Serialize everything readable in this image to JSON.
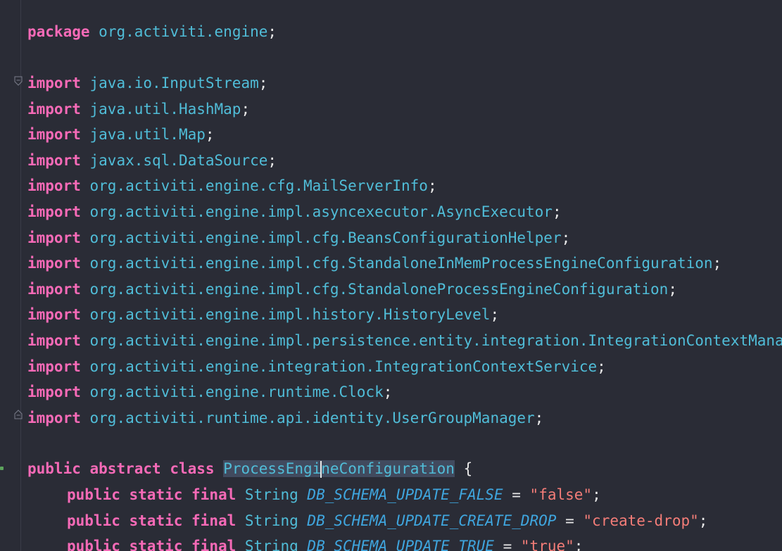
{
  "editor": {
    "package_line": {
      "keyword": "package",
      "name": "org.activiti.engine",
      "end": ";"
    },
    "imports": [
      {
        "keyword": "import",
        "path": "java.io.InputStream",
        "end": ";"
      },
      {
        "keyword": "import",
        "path": "java.util.HashMap",
        "end": ";"
      },
      {
        "keyword": "import",
        "path": "java.util.Map",
        "end": ";"
      },
      {
        "keyword": "import",
        "path": "javax.sql.DataSource",
        "end": ";"
      },
      {
        "keyword": "import",
        "path": "org.activiti.engine.cfg.MailServerInfo",
        "end": ";"
      },
      {
        "keyword": "import",
        "path": "org.activiti.engine.impl.asyncexecutor.AsyncExecutor",
        "end": ";"
      },
      {
        "keyword": "import",
        "path": "org.activiti.engine.impl.cfg.BeansConfigurationHelper",
        "end": ";"
      },
      {
        "keyword": "import",
        "path": "org.activiti.engine.impl.cfg.StandaloneInMemProcessEngineConfiguration",
        "end": ";"
      },
      {
        "keyword": "import",
        "path": "org.activiti.engine.impl.cfg.StandaloneProcessEngineConfiguration",
        "end": ";"
      },
      {
        "keyword": "import",
        "path": "org.activiti.engine.impl.history.HistoryLevel",
        "end": ";"
      },
      {
        "keyword": "import",
        "path": "org.activiti.engine.impl.persistence.entity.integration.IntegrationContextManager",
        "end": ";"
      },
      {
        "keyword": "import",
        "path": "org.activiti.engine.integration.IntegrationContextService",
        "end": ";"
      },
      {
        "keyword": "import",
        "path": "org.activiti.engine.runtime.Clock",
        "end": ";"
      },
      {
        "keyword": "import",
        "path": "org.activiti.runtime.api.identity.UserGroupManager",
        "end": ";"
      }
    ],
    "class_decl": {
      "kw1": "public",
      "kw2": "abstract",
      "kw3": "class",
      "name_before_cursor": "ProcessEngi",
      "name_after_cursor": "neConfiguration",
      "brace": "{"
    },
    "fields": [
      {
        "kw1": "public",
        "kw2": "static",
        "kw3": "final",
        "type": "String",
        "name": "DB_SCHEMA_UPDATE_FALSE",
        "eq": "=",
        "value": "\"false\"",
        "end": ";"
      },
      {
        "kw1": "public",
        "kw2": "static",
        "kw3": "final",
        "type": "String",
        "name": "DB_SCHEMA_UPDATE_CREATE_DROP",
        "eq": "=",
        "value": "\"create-drop\"",
        "end": ";"
      },
      {
        "kw1": "public",
        "kw2": "static",
        "kw3": "final",
        "type": "String",
        "name": "DB_SCHEMA_UPDATE_TRUE",
        "eq": "=",
        "value": "\"true\"",
        "end": ";"
      }
    ]
  },
  "colors": {
    "background": "#2a2c36",
    "keyword": "#f66ab7",
    "identifier": "#50bdd8",
    "constant": "#3fa6df",
    "string": "#f47d78",
    "text": "#e8e8e8"
  }
}
